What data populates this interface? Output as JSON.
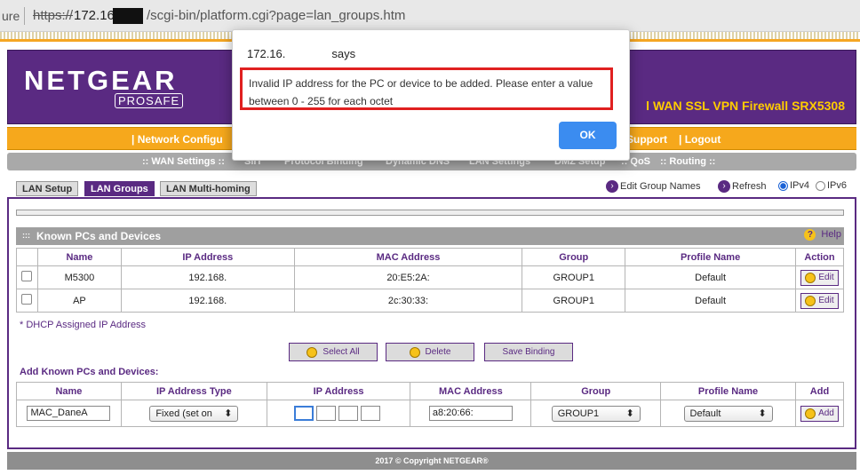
{
  "browser": {
    "secure_label": "ure",
    "protocol": "https://",
    "host": "172.16.",
    "path": "/scgi-bin/platform.cgi?page=lan_groups.htm"
  },
  "header": {
    "logo": "NETGEAR",
    "logo_sub": "PROSAFE",
    "product": "l WAN SSL VPN Firewall SRX5308"
  },
  "nav": {
    "network": "| Network Configu",
    "support": "Support",
    "logout": "| Logout"
  },
  "subnav": [
    ":: WAN Settings ::",
    "SIIT",
    "Protocol Binding",
    "Dynamic DNS",
    "LAN Settings",
    "DMZ Setup",
    ":: QoS",
    ":: Routing ::"
  ],
  "tabs": [
    "LAN Setup",
    "LAN Groups",
    "LAN Multi-homing"
  ],
  "toplinks": {
    "edit_groups": "Edit Group Names",
    "refresh": "Refresh",
    "ipv4": "IPv4",
    "ipv6": "IPv6"
  },
  "known": {
    "title": "Known PCs and Devices",
    "help": "Help",
    "columns": [
      "",
      "Name",
      "IP Address",
      "MAC Address",
      "Group",
      "Profile Name",
      "Action"
    ],
    "rows": [
      {
        "name": "M5300",
        "ip": "192.168.",
        "mac": "20:E5:2A:",
        "group": "GROUP1",
        "profile": "Default",
        "action": "Edit"
      },
      {
        "name": "AP",
        "ip": "192.168.",
        "mac": "2c:30:33:",
        "group": "GROUP1",
        "profile": "Default",
        "action": "Edit"
      }
    ],
    "dhcp_note": "* DHCP Assigned IP Address"
  },
  "buttons": {
    "select_all": "Select All",
    "delete": "Delete",
    "save_binding": "Save Binding"
  },
  "add": {
    "title": "Add Known PCs and Devices:",
    "columns": [
      "Name",
      "IP Address Type",
      "IP Address",
      "MAC Address",
      "Group",
      "Profile Name",
      "Add"
    ],
    "name_value": "MAC_DaneA",
    "ip_type": "Fixed (set on",
    "mac_value": "a8:20:66:",
    "group": "GROUP1",
    "profile": "Default",
    "add_label": "Add"
  },
  "footer": "2017 © Copyright NETGEAR®",
  "dialog": {
    "title": "172.16.",
    "says": "says",
    "message": "Invalid IP address for the PC or device to be added. Please enter a value between 0 - 255  for each octet",
    "ok": "OK"
  }
}
